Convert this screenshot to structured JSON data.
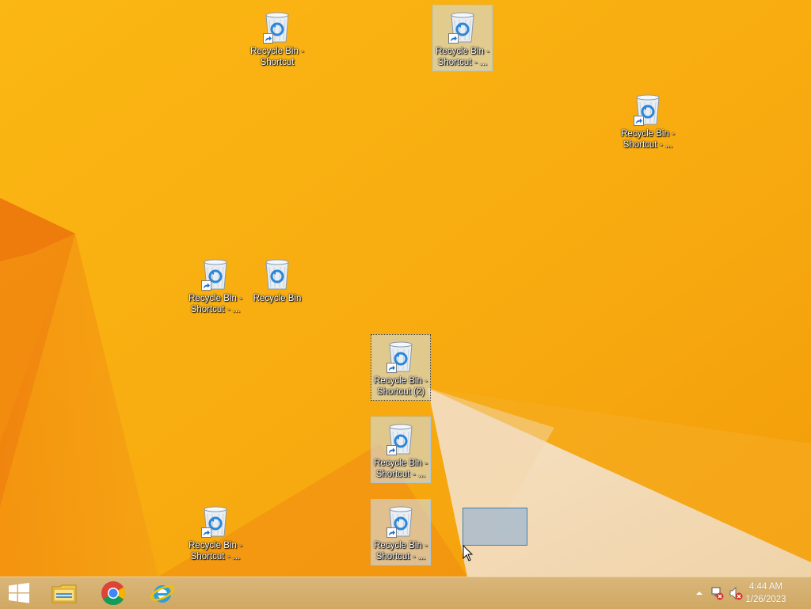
{
  "desktop": {
    "icons": [
      {
        "label": "Recycle Bin -\nShortcut",
        "shortcut": true
      },
      {
        "label": "Recycle Bin -\nShortcut - ...",
        "shortcut": true
      },
      {
        "label": "Recycle Bin -\nShortcut - ...",
        "shortcut": true
      },
      {
        "label": "Recycle Bin -\nShortcut - ...",
        "shortcut": true
      },
      {
        "label": "Recycle Bin",
        "shortcut": false
      },
      {
        "label": "Recycle Bin -\nShortcut (2)",
        "shortcut": true
      },
      {
        "label": "Recycle Bin -\nShortcut - ...",
        "shortcut": true
      },
      {
        "label": "Recycle Bin -\nShortcut - ...",
        "shortcut": true
      },
      {
        "label": "Recycle Bin -\nShortcut - ...",
        "shortcut": true
      }
    ]
  },
  "taskbar": {
    "pinned": [
      "windows-start",
      "file-explorer",
      "google-chrome",
      "internet-explorer"
    ],
    "tray": [
      "show-hidden-icons-arrow",
      "network-disconnected-icon",
      "volume-muted-icon"
    ],
    "clock": {
      "time": "4:44 AM",
      "date": "1/26/2023"
    }
  },
  "colors": {
    "wallpaper": "#f7ad10",
    "taskbar": "#d4ad6b",
    "selection": "#9fbfe0"
  }
}
